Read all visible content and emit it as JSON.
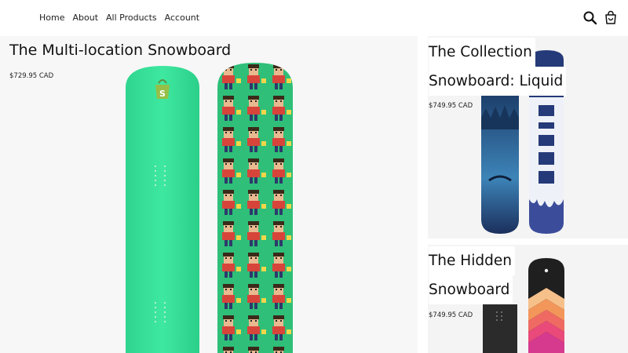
{
  "nav": {
    "items": [
      {
        "label": "Home"
      },
      {
        "label": "About"
      },
      {
        "label": "All Products"
      },
      {
        "label": "Account"
      }
    ],
    "icons": [
      "search-icon",
      "cart-icon"
    ]
  },
  "featured": {
    "title": "The Multi-location Snowboard",
    "price": "$729.95 CAD",
    "colors": {
      "green_board": "#34e39b",
      "pixel_board": "#2fbf78"
    }
  },
  "cards": [
    {
      "title_lines": [
        "The Collection",
        "Snowboard: Liquid"
      ],
      "price": "$749.95 CAD"
    },
    {
      "title_lines": [
        "The Hidden",
        "Snowboard"
      ],
      "price": "$749.95 CAD"
    }
  ]
}
